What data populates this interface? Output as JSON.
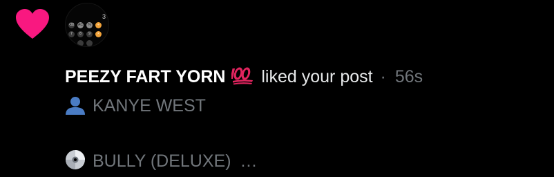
{
  "notification": {
    "icon": "heart-icon",
    "accent_color": "#f91880",
    "avatar": {
      "icon": "calculator-avatar",
      "display_digit": "3",
      "keys_row1": [
        "⌫",
        "AC",
        "%",
        "÷"
      ],
      "keys_row2": [
        "7",
        "8",
        "9",
        "×"
      ]
    },
    "user_name": "PEEZY FART YORN",
    "user_emoji": "hundred-points-icon",
    "action": "liked your post",
    "separator": "·",
    "time": "56s",
    "post_line1_icon": "bust-silhouette-icon",
    "post_line1": "KANYE WEST",
    "post_line2_icon": "optical-disc-icon",
    "post_line2": "BULLY (DELUXE)",
    "truncation": "..."
  }
}
